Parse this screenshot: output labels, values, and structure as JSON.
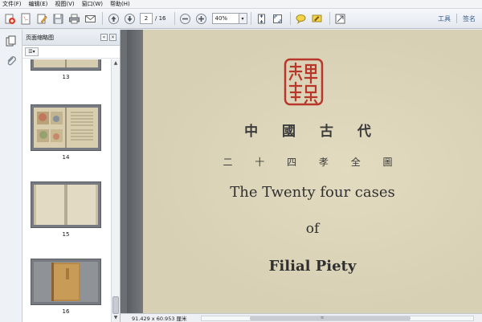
{
  "menu": {
    "items": [
      "文件(F)",
      "编辑(E)",
      "视图(V)",
      "窗口(W)",
      "帮助(H)"
    ]
  },
  "toolbar": {
    "current_page": "2",
    "page_total": "/ 16",
    "zoom": "40%",
    "tools_label": "工具",
    "sign_label": "签名",
    "icons": [
      "create-pdf-icon",
      "pdf-icon",
      "edit-icon",
      "save-icon",
      "print-icon",
      "email-icon",
      "page-up-icon",
      "page-down-icon",
      "zoom-out-icon",
      "zoom-in-icon",
      "fit-page-icon",
      "full-screen-icon",
      "comment-icon",
      "highlight-icon",
      "expand-icon"
    ]
  },
  "panel": {
    "title": "页面缩略图",
    "options_label": "☰▾",
    "thumbnails": [
      {
        "label": "13"
      },
      {
        "label": "14"
      },
      {
        "label": "15"
      },
      {
        "label": "16"
      }
    ]
  },
  "document": {
    "chinese_title": "中 國 古 代",
    "chinese_subtitle": "二 十 四 孝 全 圖",
    "english_title": "The Twenty four cases",
    "english_of": "of",
    "english_subtitle": "Filial Piety",
    "seal_color": "#b8362a"
  },
  "status": {
    "page_size": "91.429 x 60.953 厘米"
  }
}
